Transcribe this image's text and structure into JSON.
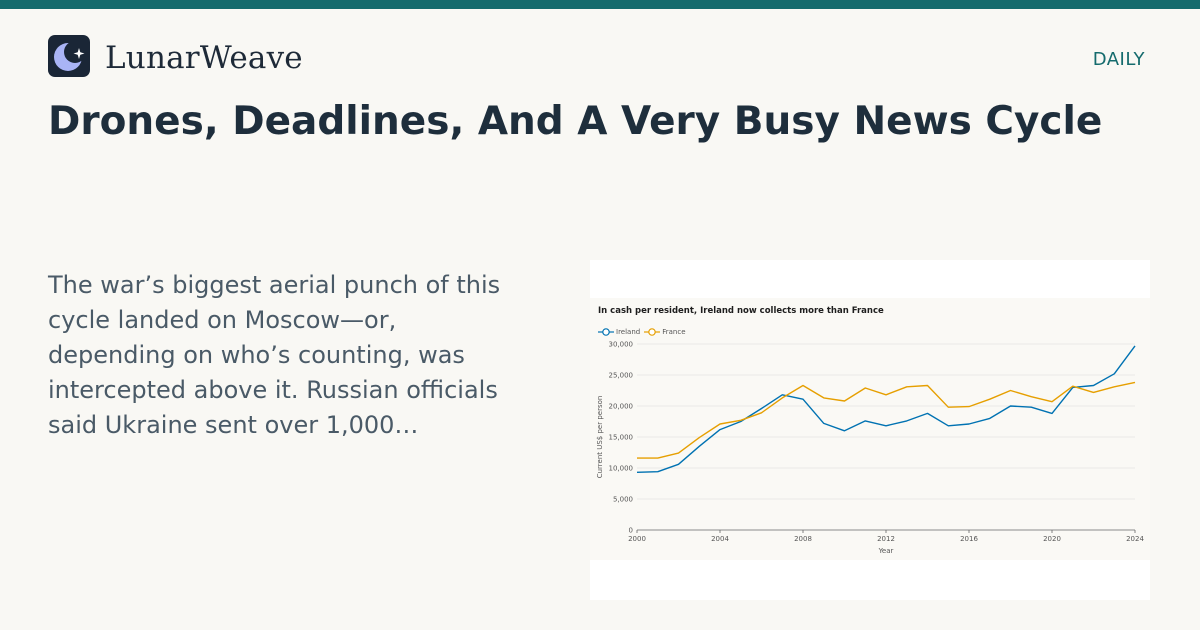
{
  "site": {
    "name": "LunarWeave",
    "section": "DAILY",
    "logo_icon": "moon-star-icon",
    "accent_color": "#156b6d"
  },
  "article": {
    "headline": "Drones, Deadlines, And A Very Busy News Cycle",
    "excerpt": "The war’s biggest aerial punch of this cycle landed on Moscow—or, depending on who’s counting, was intercepted above it. Russian officials said Ukraine sent over 1,000…"
  },
  "chart_data": {
    "type": "line",
    "title": "In cash per resident, Ireland now collects more than France",
    "xlabel": "Year",
    "ylabel": "Current US$ per person",
    "xlim": [
      2000,
      2024
    ],
    "ylim": [
      0,
      30000
    ],
    "x_ticks": [
      2000,
      2004,
      2008,
      2012,
      2016,
      2020,
      2024
    ],
    "y_ticks": [
      0,
      5000,
      10000,
      15000,
      20000,
      25000,
      30000
    ],
    "y_tick_labels": [
      "0",
      "5,000",
      "10,000",
      "15,000",
      "20,000",
      "25,000",
      "30,000"
    ],
    "grid": true,
    "legend_position": "top-left",
    "x": [
      2000,
      2001,
      2002,
      2003,
      2004,
      2005,
      2006,
      2007,
      2008,
      2009,
      2010,
      2011,
      2012,
      2013,
      2014,
      2015,
      2016,
      2017,
      2018,
      2019,
      2020,
      2021,
      2022,
      2023,
      2024
    ],
    "series": [
      {
        "name": "Ireland",
        "color": "#0072b2",
        "values": [
          9300,
          9400,
          10600,
          13500,
          16200,
          17500,
          19600,
          21800,
          21100,
          17200,
          16000,
          17600,
          16800,
          17600,
          18800,
          16800,
          17100,
          18000,
          20000,
          19800,
          18800,
          23000,
          23300,
          25200,
          29700
        ]
      },
      {
        "name": "France",
        "color": "#e69f00",
        "values": [
          11600,
          11600,
          12400,
          14900,
          17100,
          17700,
          18900,
          21300,
          23300,
          21300,
          20800,
          22900,
          21800,
          23100,
          23300,
          19800,
          19900,
          21100,
          22500,
          21500,
          20700,
          23200,
          22200,
          23100,
          23800
        ]
      }
    ]
  }
}
